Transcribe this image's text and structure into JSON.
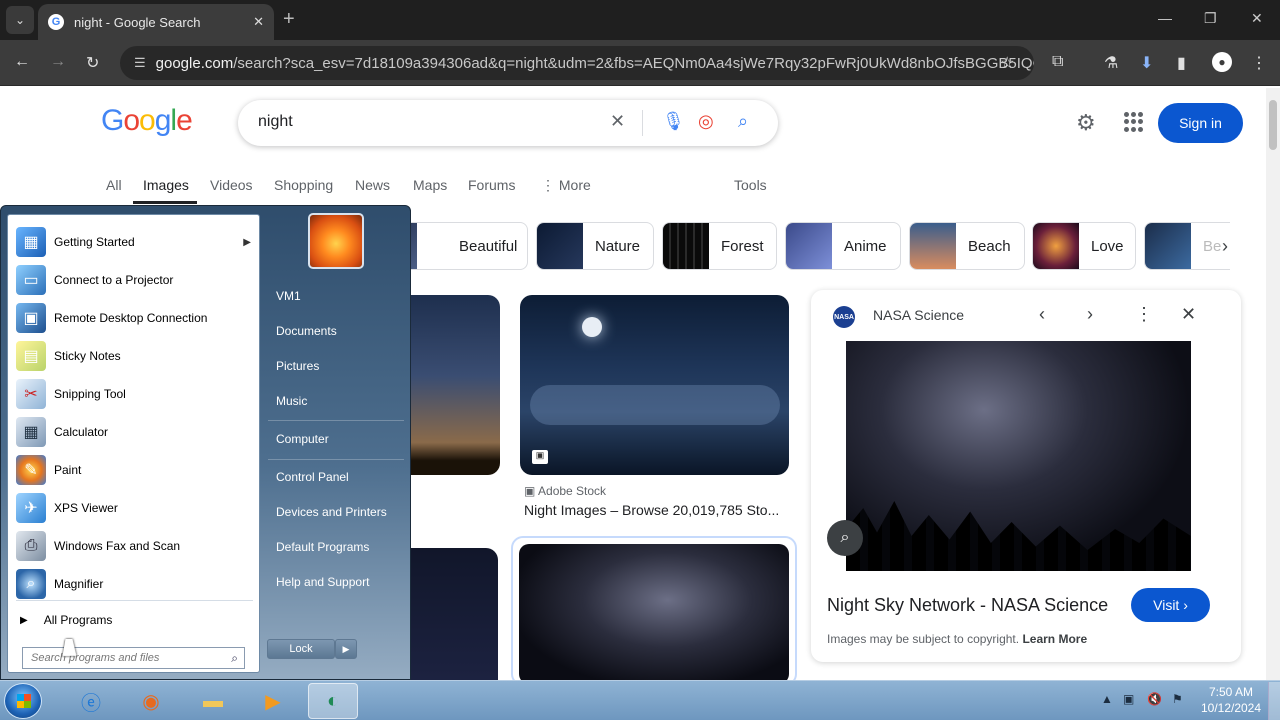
{
  "browser": {
    "tab_title": "night - Google Search",
    "tab_close": "✕",
    "new_tab": "+",
    "url_host": "google.com",
    "url_path": "/search?sca_esv=7d18109a394306ad&q=night&udm=2&fbs=AEQNm0Aa4sjWe7Rqy32pFwRj0UkWd8nbOJfsBGGB5IQQO..."
  },
  "google": {
    "logo": [
      "G",
      "o",
      "o",
      "g",
      "l",
      "e"
    ],
    "logo_colors": [
      "#4285f4",
      "#ea4335",
      "#fbbc05",
      "#4285f4",
      "#34a853",
      "#ea4335"
    ],
    "query": "night",
    "sign_in": "Sign in",
    "tabs": [
      "All",
      "Images",
      "Videos",
      "Shopping",
      "News",
      "Maps",
      "Forums",
      "More",
      "Tools"
    ],
    "chips": [
      "Beautiful",
      "Nature",
      "Forest",
      "Anime",
      "Beach",
      "Love",
      "Be"
    ],
    "results": {
      "second": {
        "source": "Adobe Stock",
        "caption": "Night Images – Browse 20,019,785 Sto..."
      }
    },
    "panel": {
      "site": "NASA Science",
      "logo_text": "NASA",
      "title": "Night Sky Network - NASA Science",
      "visit": "Visit ›",
      "copyright": "Images may be subject to copyright.",
      "learn_more": "Learn More"
    }
  },
  "start_menu": {
    "programs": [
      {
        "label": "Getting Started",
        "icon": "getting-started-icon",
        "has_arrow": true
      },
      {
        "label": "Connect to a Projector",
        "icon": "projector-icon"
      },
      {
        "label": "Remote Desktop Connection",
        "icon": "remote-desktop-icon"
      },
      {
        "label": "Sticky Notes",
        "icon": "sticky-notes-icon"
      },
      {
        "label": "Snipping Tool",
        "icon": "scissors-icon"
      },
      {
        "label": "Calculator",
        "icon": "calculator-icon"
      },
      {
        "label": "Paint",
        "icon": "paint-icon"
      },
      {
        "label": "XPS Viewer",
        "icon": "xps-viewer-icon"
      },
      {
        "label": "Windows Fax and Scan",
        "icon": "fax-icon"
      },
      {
        "label": "Magnifier",
        "icon": "magnifier-icon"
      }
    ],
    "all_programs": "All Programs",
    "search_placeholder": "Search programs and files",
    "user": "VM1",
    "right_links": [
      "Documents",
      "Pictures",
      "Music",
      "Computer",
      "Control Panel",
      "Devices and Printers",
      "Default Programs",
      "Help and Support"
    ],
    "lock": "Lock"
  },
  "taskbar": {
    "time": "7:50 AM",
    "date": "10/12/2024"
  }
}
